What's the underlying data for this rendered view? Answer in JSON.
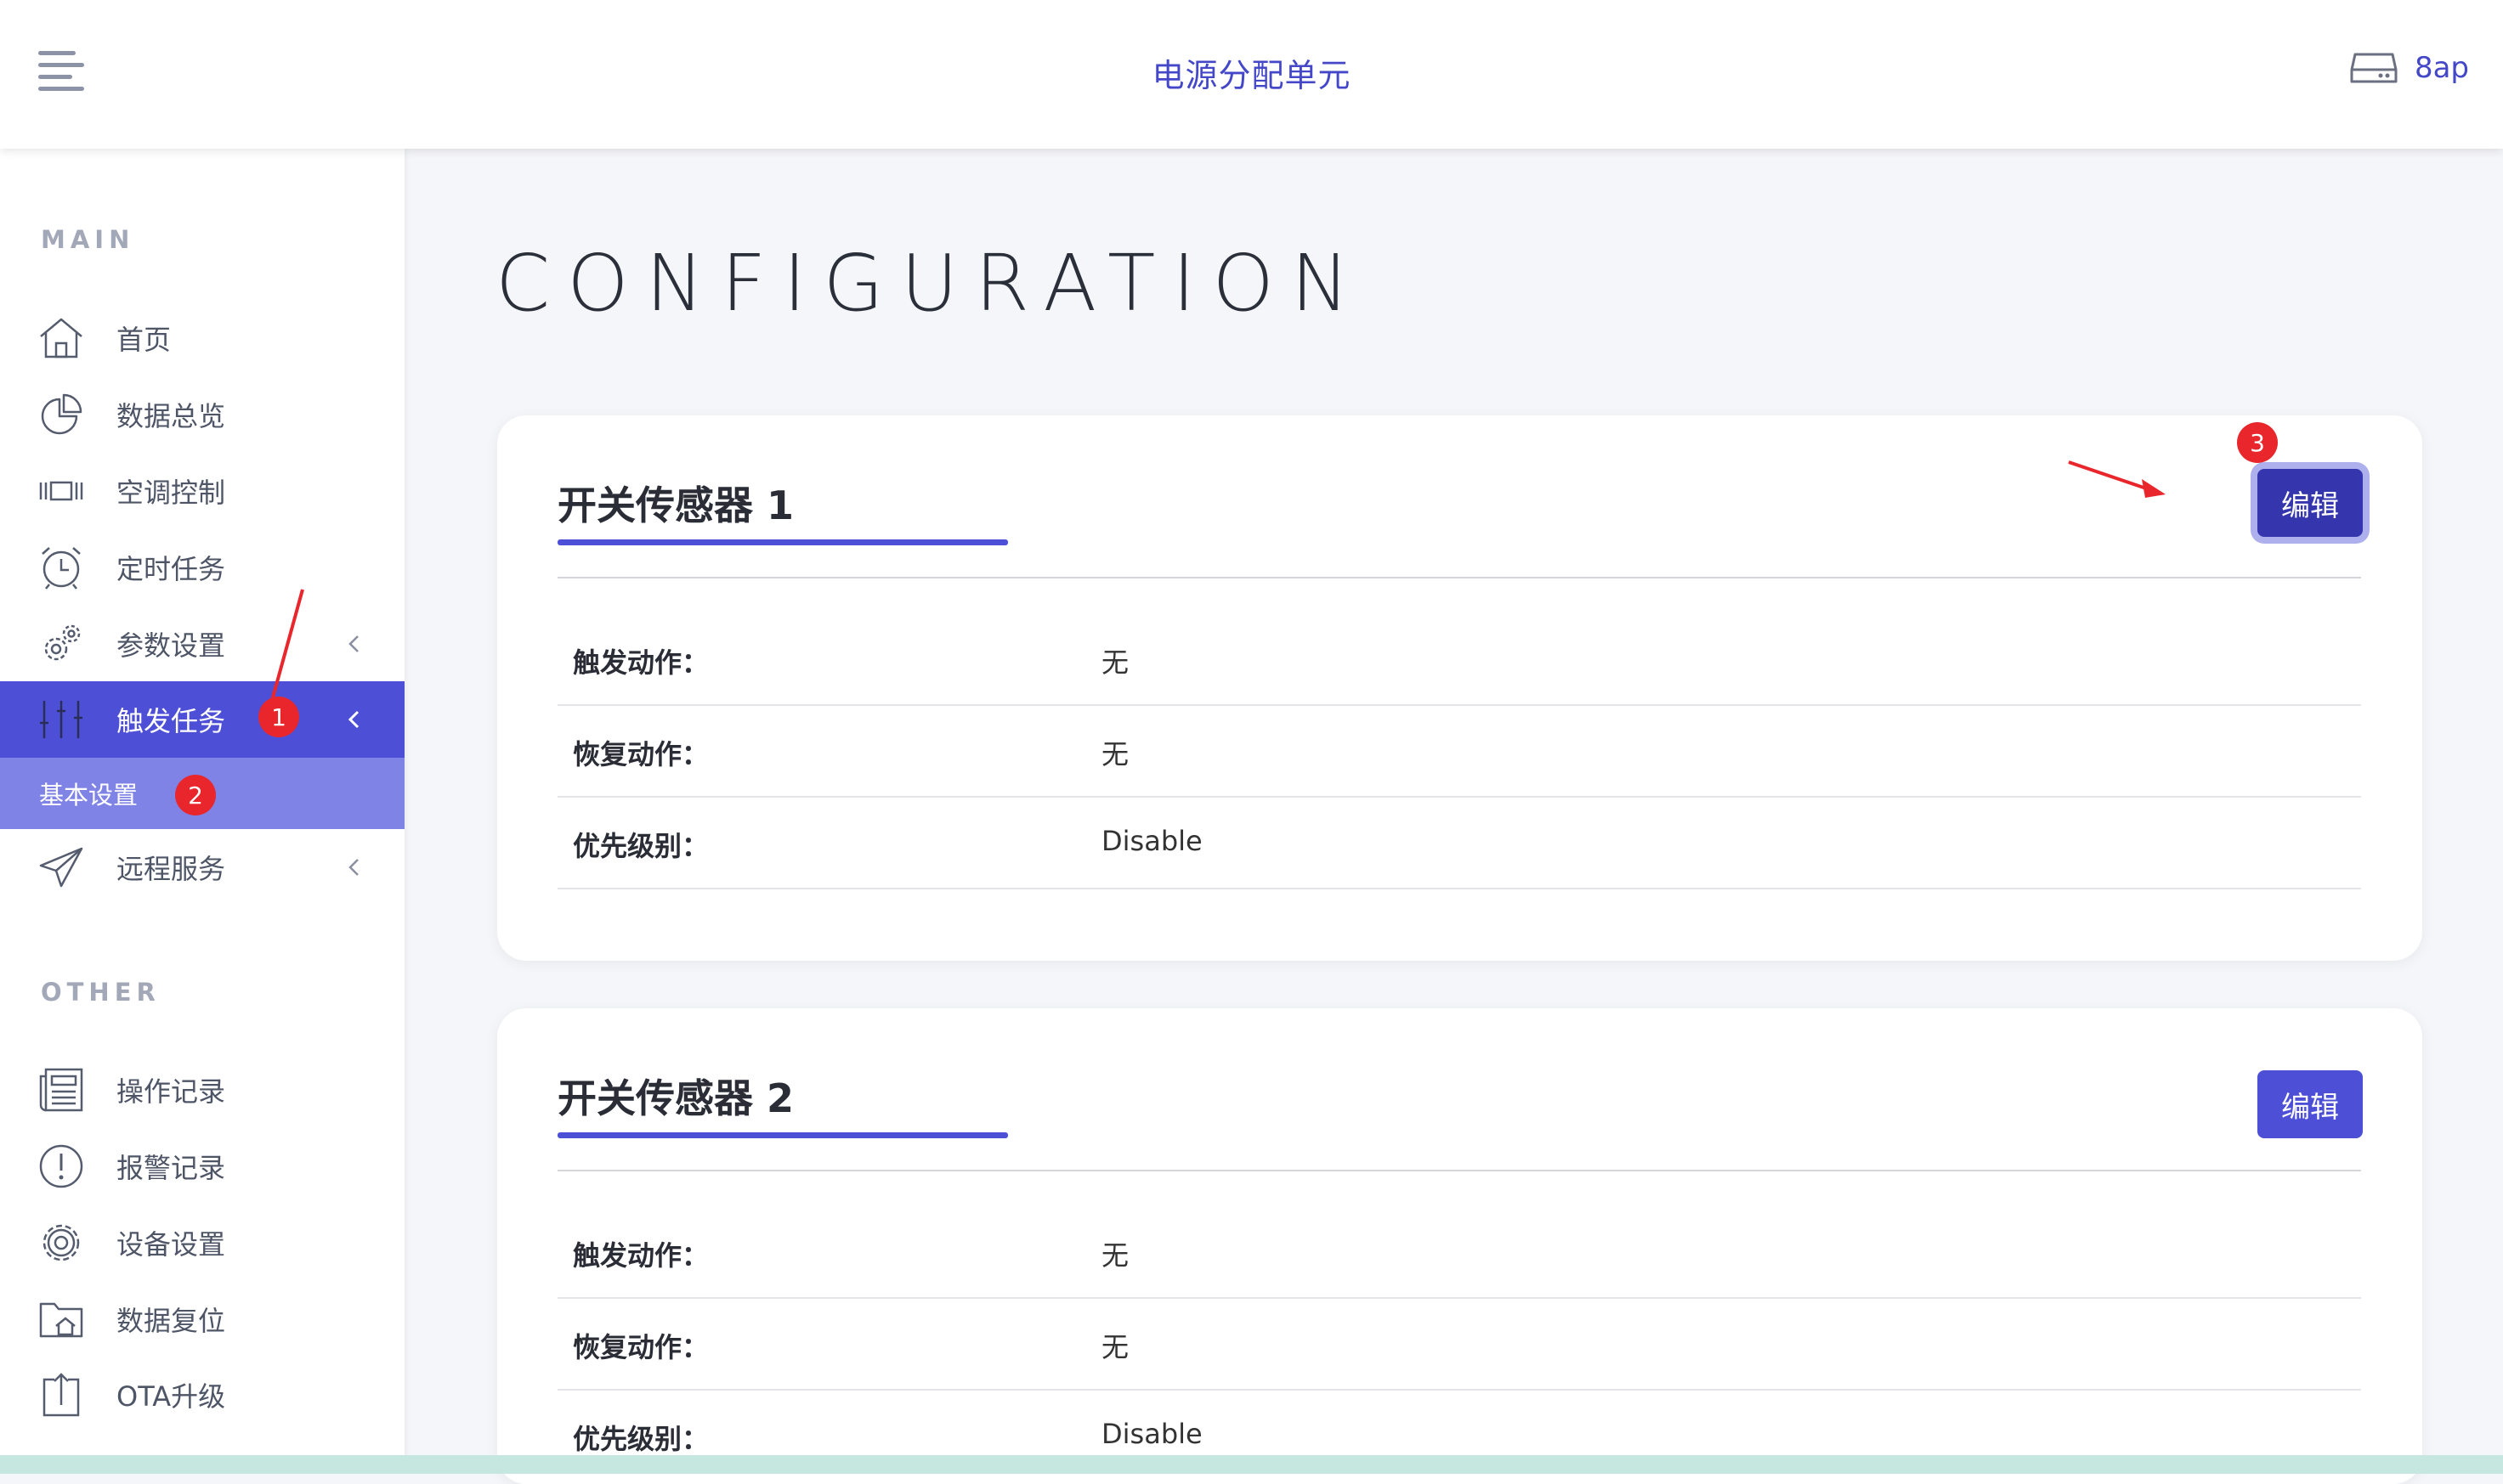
{
  "header": {
    "app_title": "电源分配单元",
    "device_name": "8ap",
    "menu_icon": "hamburger-menu-icon",
    "device_icon": "hard-drive-icon"
  },
  "sidebar": {
    "main_label": "MAIN",
    "other_label": "OTHER",
    "main_items": [
      {
        "label": "首页",
        "icon": "home-icon"
      },
      {
        "label": "数据总览",
        "icon": "pie-chart-icon"
      },
      {
        "label": "空调控制",
        "icon": "air-conditioner-icon"
      },
      {
        "label": "定时任务",
        "icon": "alarm-clock-icon"
      },
      {
        "label": "参数设置",
        "icon": "gears-icon"
      },
      {
        "label": "触发任务",
        "icon": "sliders-icon"
      },
      {
        "label": "远程服务",
        "icon": "paper-plane-icon"
      }
    ],
    "submenu_item": "基本设置",
    "other_items": [
      {
        "label": "操作记录",
        "icon": "newspaper-icon"
      },
      {
        "label": "报警记录",
        "icon": "alert-circle-icon"
      },
      {
        "label": "设备设置",
        "icon": "gear-icon"
      },
      {
        "label": "数据复位",
        "icon": "folder-home-icon"
      },
      {
        "label": "OTA升级",
        "icon": "upload-icon"
      }
    ]
  },
  "annotations": [
    "1",
    "2",
    "3"
  ],
  "main": {
    "page_title": "CONFIGURATION",
    "cards": [
      {
        "title": "开关传感器 1",
        "edit_label": "编辑",
        "rows": [
          {
            "key": "触发动作：",
            "value": "无"
          },
          {
            "key": "恢复动作：",
            "value": "无"
          },
          {
            "key": "优先级别：",
            "value": "Disable"
          }
        ]
      },
      {
        "title": "开关传感器 2",
        "edit_label": "编辑",
        "rows": [
          {
            "key": "触发动作：",
            "value": "无"
          },
          {
            "key": "恢复动作：",
            "value": "无"
          },
          {
            "key": "优先级别：",
            "value": "Disable"
          }
        ]
      }
    ]
  },
  "colors": {
    "accent": "#4d50d6",
    "submenu": "#7f83e6",
    "annotation": "#e8262c"
  }
}
